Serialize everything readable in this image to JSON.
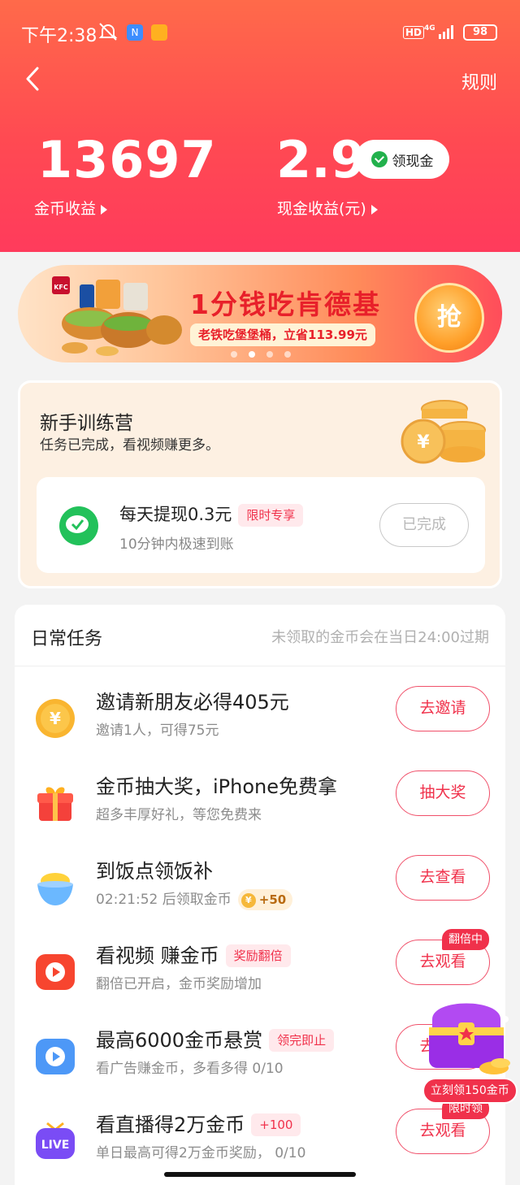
{
  "status_bar": {
    "time": "下午2:38",
    "hd": "HD",
    "network": "4G",
    "battery": "98"
  },
  "header": {
    "rules_label": "规则",
    "coins": {
      "value": "13697",
      "label": "金币收益"
    },
    "cash": {
      "value": "2.9",
      "label": "现金收益(元)"
    },
    "withdraw_button": "领现金"
  },
  "banner": {
    "title": "1分钱吃肯德基",
    "subtitle": "老铁吃堡堡桶，立省113.99元",
    "grab_button": "抢",
    "carousel": {
      "count": 4,
      "active_index": 1
    }
  },
  "training": {
    "title": "新手训练营",
    "subtitle": "任务已完成，看视频赚更多。",
    "card": {
      "title": "每天提现0.3元",
      "tag": "限时专享",
      "subtitle": "10分钟内极速到账",
      "button": "已完成"
    }
  },
  "daily": {
    "title": "日常任务",
    "note": "未领取的金币会在当日24:00过期",
    "tasks": [
      {
        "icon": "coin-icon",
        "title": "邀请新朋友必得405元",
        "subtitle": "邀请1人，可得75元",
        "button": "去邀请"
      },
      {
        "icon": "gift-icon",
        "title": "金币抽大奖，iPhone免费拿",
        "subtitle": "超多丰厚好礼，等您免费来",
        "button": "抽大奖"
      },
      {
        "icon": "rice-bowl-icon",
        "title": "到饭点领饭补",
        "subtitle": "02:21:52 后领取金币",
        "reward": "+50",
        "button": "去查看"
      },
      {
        "icon": "video-play-icon",
        "title": "看视频 赚金币",
        "tag": "奖励翻倍",
        "subtitle": "翻倍已开启，金币奖励增加",
        "button": "去观看",
        "button_badge": "翻倍中"
      },
      {
        "icon": "ad-play-icon",
        "title": "最高6000金币悬赏",
        "tag": "领完即止",
        "subtitle": "看广告赚金币，多看多得 0/10",
        "button": "去观看"
      },
      {
        "icon": "live-icon",
        "title": "看直播得2万金币",
        "tag": "+100",
        "subtitle": "单日最高可得2万金币奖励，  0/10",
        "button": "去观看",
        "button_badge": "限时领"
      }
    ]
  },
  "floating_chest": {
    "label": "立刻领150金币"
  },
  "colors": {
    "accent": "#f0314b",
    "header_top": "#ff6a4a",
    "header_bottom": "#ff3b5c",
    "wechat_green": "#22c15a"
  }
}
